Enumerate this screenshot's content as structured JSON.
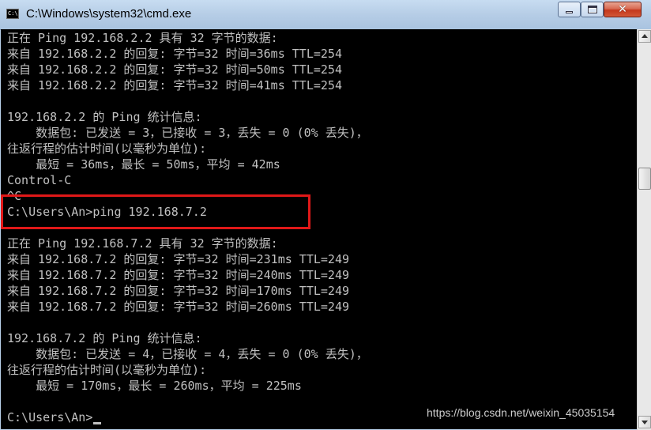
{
  "window": {
    "title": "C:\\Windows\\system32\\cmd.exe",
    "app_icon_text": "C:\\",
    "close_glyph": "✕"
  },
  "console": {
    "lines": [
      "正在 Ping 192.168.2.2 具有 32 字节的数据:",
      "来自 192.168.2.2 的回复: 字节=32 时间=36ms TTL=254",
      "来自 192.168.2.2 的回复: 字节=32 时间=50ms TTL=254",
      "来自 192.168.2.2 的回复: 字节=32 时间=41ms TTL=254",
      "",
      "192.168.2.2 的 Ping 统计信息:",
      "    数据包: 已发送 = 3，已接收 = 3，丢失 = 0 (0% 丢失)，",
      "往返行程的估计时间(以毫秒为单位):",
      "    最短 = 36ms，最长 = 50ms，平均 = 42ms",
      "Control-C",
      "^C",
      "C:\\Users\\An>ping 192.168.7.2",
      "",
      "正在 Ping 192.168.7.2 具有 32 字节的数据:",
      "来自 192.168.7.2 的回复: 字节=32 时间=231ms TTL=249",
      "来自 192.168.7.2 的回复: 字节=32 时间=240ms TTL=249",
      "来自 192.168.7.2 的回复: 字节=32 时间=170ms TTL=249",
      "来自 192.168.7.2 的回复: 字节=32 时间=260ms TTL=249",
      "",
      "192.168.7.2 的 Ping 统计信息:",
      "    数据包: 已发送 = 4，已接收 = 4，丢失 = 0 (0% 丢失)，",
      "往返行程的估计时间(以毫秒为单位):",
      "    最短 = 170ms，最长 = 260ms，平均 = 225ms",
      "",
      "C:\\Users\\An>"
    ],
    "text_color": "#c0c0c0",
    "background": "#000000",
    "highlight_color": "#e01818"
  },
  "watermark": "https://blog.csdn.net/weixin_45035154"
}
